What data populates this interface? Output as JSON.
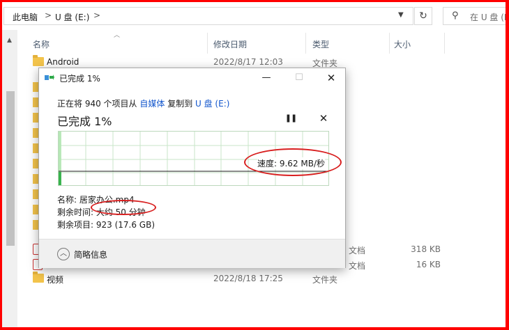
{
  "address": {
    "crumbs": [
      "此电脑",
      "U 盘 (E:)"
    ],
    "separator": ">",
    "dropdown_icon": "chevron-down-icon",
    "refresh_icon": "refresh-icon",
    "search_placeholder": "在 U 盘 (E:) 中搜索"
  },
  "columns": {
    "name": "名称",
    "date": "修改日期",
    "type": "类型",
    "size": "大小"
  },
  "files": [
    {
      "name": "Android",
      "date": "2022/8/17 12:03",
      "type": "文件夹",
      "size": "",
      "icon": "folder-icon"
    },
    {
      "name": "",
      "date": "",
      "type": "文档",
      "size": "318 KB",
      "icon": "video-file-icon"
    },
    {
      "name": "",
      "date": "",
      "type": "文档",
      "size": "16 KB",
      "icon": "video-file-icon"
    },
    {
      "name": "视频",
      "date": "2022/8/18 17:25",
      "type": "文件夹",
      "size": "",
      "icon": "folder-icon"
    }
  ],
  "dialog": {
    "title": "已完成 1%",
    "minimize": "—",
    "maximize": "☐",
    "close": "✕",
    "line_prefix": "正在将 940 个项目从 ",
    "source": "自媒体",
    "line_mid": " 复制到 ",
    "destination": "U 盘 (E:)",
    "progress_title": "已完成 1%",
    "pause": "❚❚",
    "cancel": "✕",
    "speed": "速度: 9.62 MB/秒",
    "progress": 0.01,
    "name_line": "名称: 居家办公.mp4",
    "time_label": "剩余时间: ",
    "time_value": "大约 50 分钟",
    "items_line": "剩余项目: 923 (17.6 GB)",
    "details_label": "简略信息",
    "details_icon": "chevron-up-icon"
  },
  "colors": {
    "border": "#ff0000",
    "annotation": "#d81e1e",
    "link": "#1155cc",
    "graph_fill": "#37b24d"
  }
}
